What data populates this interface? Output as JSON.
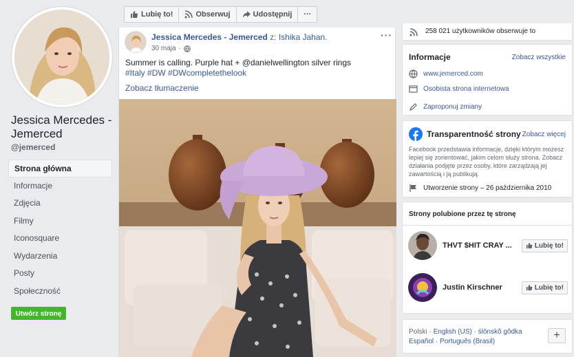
{
  "page": {
    "name": "Jessica Mercedes - Jemerced",
    "handle": "@jemerced",
    "avatar_description": "profile-photo"
  },
  "nav": {
    "items": [
      {
        "label": "Strona główna",
        "active": true
      },
      {
        "label": "Informacje"
      },
      {
        "label": "Zdjęcia"
      },
      {
        "label": "Filmy"
      },
      {
        "label": "Iconosquare"
      },
      {
        "label": "Wydarzenia"
      },
      {
        "label": "Posty"
      },
      {
        "label": "Społeczność"
      }
    ],
    "create_page_label": "Utwórz stronę"
  },
  "actions": {
    "like": "Lubię to!",
    "follow": "Obserwuj",
    "share": "Udostępnij",
    "more": "···"
  },
  "post": {
    "author": "Jessica Mercedes - Jemerced",
    "via_prefix": "z:",
    "via_name": "Ishika Jahan.",
    "date": "30 maja",
    "date_sep": "·",
    "text": "Summer is calling. Purple hat + @danielwellington silver rings",
    "tags": "#Italy #DW #DWcompletethelook",
    "translate": "Zobacz tłumaczenie",
    "more": "···"
  },
  "sidebar": {
    "followers_text": "258 021 użytkowników obserwuje to",
    "info": {
      "title": "Informacje",
      "see_all": "Zobacz wszystkie",
      "website": "www.jemerced.com",
      "category": "Osobista strona internetowa",
      "suggest": "Zaproponuj zmiany"
    },
    "transparency": {
      "title": "Transparentność strony",
      "see_more": "Zobacz więcej",
      "description": "Facebook przedstawia informacje, dzięki którym możesz lepiej się zorientować, jakim celom służy strona. Zobacz działania podjęte przez osoby, które zarządzają jej zawartością i ją publikują.",
      "created": "Utworzenie strony – 26 października 2010"
    },
    "liked": {
      "title": "Strony polubione przez tę stronę",
      "pages": [
        {
          "name": "THVT $HIT CRAY ...",
          "button": "Lubię to!"
        },
        {
          "name": "Justin Kirschner",
          "button": "Lubię to!"
        }
      ]
    },
    "languages": {
      "current": "Polski",
      "sep": "·",
      "l1": "English (US)",
      "l2": "ślōnskŏ gŏdka",
      "l3": "Español",
      "l4": "Português (Brasil)",
      "plus": "+"
    }
  },
  "colors": {
    "link": "#385898",
    "create_button": "#42b72a",
    "facebook_blue": "#1877f2",
    "background": "#e9ebee"
  }
}
